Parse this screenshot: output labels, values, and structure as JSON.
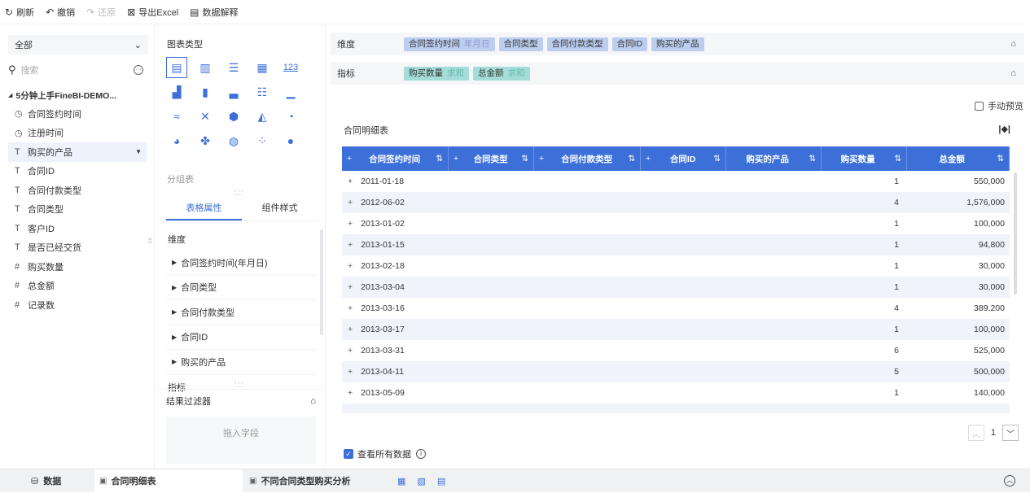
{
  "toolbar": {
    "refresh": "刷新",
    "undo": "撤销",
    "redo": "还原",
    "export": "导出Excel",
    "explain": "数据解释"
  },
  "field_panel": {
    "select_value": "全部",
    "search_placeholder": "搜索",
    "root": "5分钟上手FineBI-DEMO...",
    "fields": [
      {
        "icon": "clock-icon",
        "glyph": "◷",
        "label": "合同签约时间"
      },
      {
        "icon": "clock-icon",
        "glyph": "◷",
        "label": "注册时间"
      },
      {
        "icon": "text-type-icon",
        "glyph": "T",
        "label": "购买的产品"
      },
      {
        "icon": "text-type-icon",
        "glyph": "T",
        "label": "合同ID"
      },
      {
        "icon": "text-type-icon",
        "glyph": "T",
        "label": "合同付款类型"
      },
      {
        "icon": "text-type-icon",
        "glyph": "T",
        "label": "合同类型"
      },
      {
        "icon": "text-type-icon",
        "glyph": "T",
        "label": "客户ID"
      },
      {
        "icon": "text-type-icon",
        "glyph": "T",
        "label": "是否已经交货"
      },
      {
        "icon": "number-type-icon",
        "glyph": "#",
        "label": "购买数量"
      },
      {
        "icon": "number-type-icon",
        "glyph": "#",
        "label": "总金额"
      },
      {
        "icon": "count-type-icon",
        "glyph": "#",
        "label": "记录数"
      }
    ]
  },
  "chart_panel": {
    "title": "图表类型",
    "group_label": "分组表",
    "tabs": [
      "表格属性",
      "组件样式"
    ],
    "attr_title": "维度",
    "attr_items": [
      "合同签约时间(年月日)",
      "合同类型",
      "合同付款类型",
      "合同ID",
      "购买的产品"
    ],
    "metric_title": "指标",
    "filter_title": "结果过滤器",
    "drop_hint": "拖入字段",
    "number_icon_label": "123"
  },
  "shelves": {
    "dim_label": "维度",
    "metric_label": "指标",
    "dims": [
      {
        "name": "合同签约时间",
        "sub": "年月日"
      },
      {
        "name": "合同类型",
        "sub": ""
      },
      {
        "name": "合同付款类型",
        "sub": ""
      },
      {
        "name": "合同ID",
        "sub": ""
      },
      {
        "name": "购买的产品",
        "sub": ""
      }
    ],
    "metrics": [
      {
        "name": "购买数量",
        "sub": "求和"
      },
      {
        "name": "总金额",
        "sub": "求和"
      }
    ]
  },
  "manual_preview": "手动预览",
  "table": {
    "title": "合同明细表",
    "headers": [
      "合同签约时间",
      "合同类型",
      "合同付款类型",
      "合同ID",
      "购买的产品",
      "购买数量",
      "总金额"
    ],
    "rows": [
      {
        "date": "2011-01-18",
        "qty": "1",
        "amount": "550,000"
      },
      {
        "date": "2012-06-02",
        "qty": "4",
        "amount": "1,576,000"
      },
      {
        "date": "2013-01-02",
        "qty": "1",
        "amount": "100,000"
      },
      {
        "date": "2013-01-15",
        "qty": "1",
        "amount": "94,800"
      },
      {
        "date": "2013-02-18",
        "qty": "1",
        "amount": "30,000"
      },
      {
        "date": "2013-03-04",
        "qty": "1",
        "amount": "30,000"
      },
      {
        "date": "2013-03-16",
        "qty": "4",
        "amount": "389,200"
      },
      {
        "date": "2013-03-17",
        "qty": "1",
        "amount": "100,000"
      },
      {
        "date": "2013-03-31",
        "qty": "6",
        "amount": "525,000"
      },
      {
        "date": "2013-04-11",
        "qty": "5",
        "amount": "500,000"
      },
      {
        "date": "2013-05-09",
        "qty": "1",
        "amount": "140,000"
      },
      {
        "date": "",
        "qty": "",
        "amount": ""
      }
    ]
  },
  "pager": {
    "page": "1"
  },
  "view_all": "查看所有数据",
  "bottom": {
    "data": "数据",
    "tabs": [
      "合同明细表",
      "不同合同类型购买分析"
    ]
  },
  "colors": {
    "accent": "#3d6fd9",
    "dim_pill": "#bccdef",
    "metric_pill": "#a4dcd7",
    "row_alt": "#f0f3fa"
  }
}
